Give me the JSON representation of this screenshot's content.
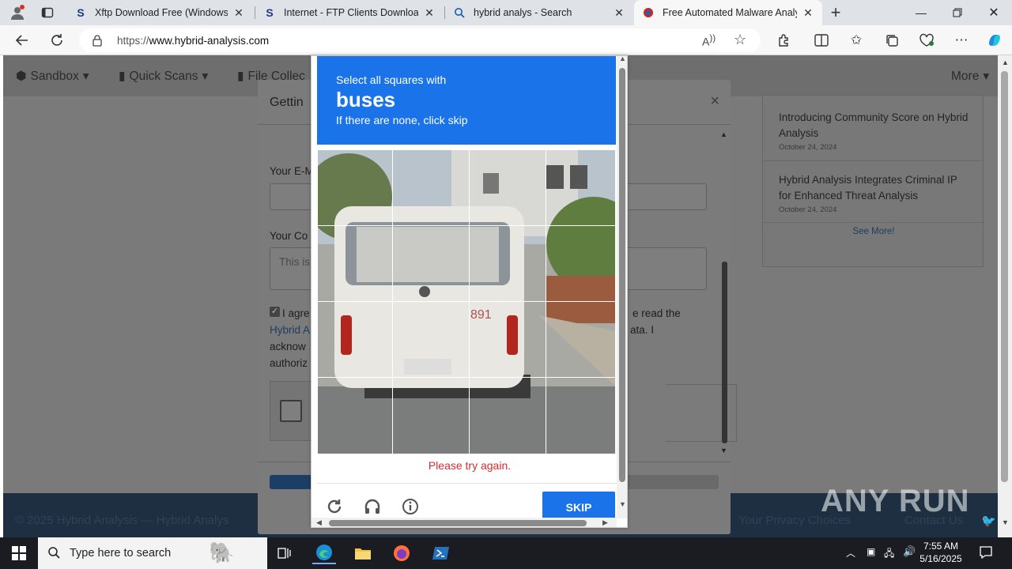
{
  "tabs": [
    {
      "title": "Xftp Download Free (Windows) -",
      "favicon": "S"
    },
    {
      "title": "Internet - FTP Clients Downloads",
      "favicon": "S"
    },
    {
      "title": "hybrid analys - Search",
      "favicon": "search-icon"
    },
    {
      "title": "Free Automated Malware Analysi",
      "favicon": "hybrid-analysis-icon",
      "active": true
    }
  ],
  "address": {
    "prefix": "https://",
    "host": "www.hybrid-analysis.com"
  },
  "site": {
    "nav": [
      "Sandbox",
      "Quick Scans",
      "File Collec",
      "More"
    ],
    "side_items": [
      {
        "title": "Introducing Community Score on Hybrid Analysis",
        "date": "October 24, 2024"
      },
      {
        "title": "Hybrid Analysis Integrates Criminal IP for Enhanced Threat Analysis",
        "date": "October 24, 2024"
      }
    ],
    "see_more": "See More!",
    "footer_left": "© 2025 Hybrid Analysis — Hybrid Analys",
    "footer_right": "Your Privacy Choices",
    "footer_contact": "Contact Us"
  },
  "modal": {
    "title": "Gettin",
    "email_label": "Your E-M",
    "comment_label": "Your Co",
    "comment_placeholder": "This is",
    "consent_line1_a": "I agre",
    "consent_line1_b": "e read the",
    "consent_line2_a": "Hybrid A",
    "consent_line2_b": "ata. I",
    "consent_line3": "acknow",
    "consent_line4": "authoriz",
    "consent_checked": true
  },
  "captcha": {
    "instruction": "Select all squares with",
    "target": "buses",
    "hint": "If there are none, click skip",
    "error": "Please try again.",
    "skip_label": "SKIP",
    "grid": "4x4",
    "bus_number": "891"
  },
  "watermark": "ANY RUN",
  "taskbar": {
    "search_placeholder": "Type here to search",
    "time": "7:55 AM",
    "date": "5/16/2025"
  },
  "colors": {
    "captcha_blue": "#1a73e8",
    "error_red": "#d32f2f",
    "footer": "#1e2f42"
  }
}
